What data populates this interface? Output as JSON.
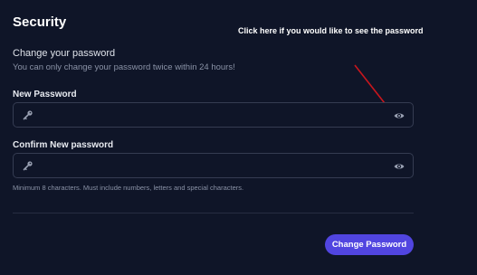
{
  "section": {
    "title": "Security",
    "annotation": "Click here if you would like to see the password"
  },
  "change_password": {
    "heading": "Change your password",
    "hint": "You can only change your password twice within 24 hours!"
  },
  "new_password": {
    "label": "New Password",
    "value": "",
    "placeholder": ""
  },
  "confirm_password": {
    "label": "Confirm New password",
    "value": "",
    "placeholder": ""
  },
  "requirements": "Minimum 8 characters. Must include numbers, letters and special characters.",
  "submit_label": "Change Password",
  "icons": {
    "field_icon": "key-icon",
    "toggle_icon": "eye-icon"
  },
  "colors": {
    "background": "#0f1528",
    "accent": "#5145e0",
    "annotation_arrow": "#c8161d"
  }
}
